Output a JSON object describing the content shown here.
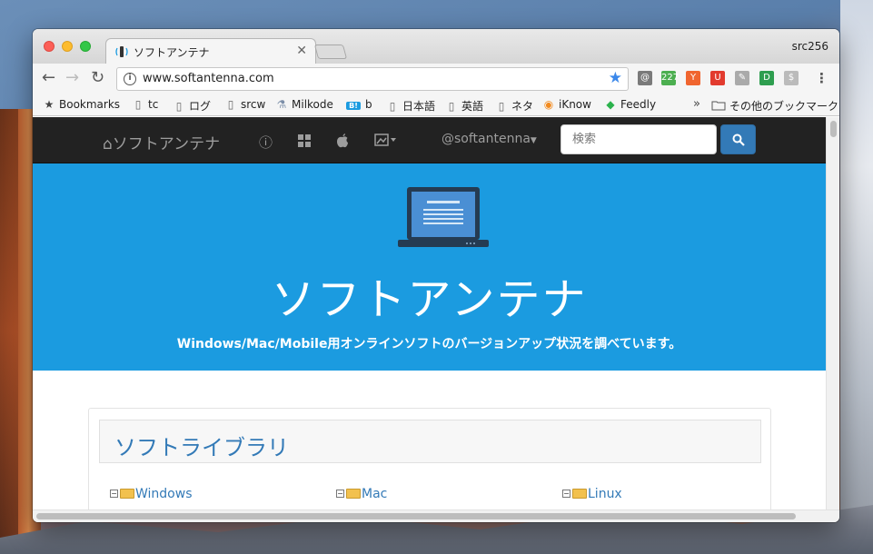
{
  "browser": {
    "tab_title": "ソフトアンテナ",
    "tab_close": "✕",
    "profile_name": "src256",
    "url": "www.softantenna.com",
    "extensions": [
      {
        "name": "clipper",
        "label": "@",
        "color": "#7a7a7a"
      },
      {
        "name": "badge",
        "label": "227",
        "color": "#4caf50"
      },
      {
        "name": "hacker-news",
        "label": "Y",
        "color": "#f0652f"
      },
      {
        "name": "ublock",
        "label": "U",
        "color": "#e23b2e"
      },
      {
        "name": "pin",
        "label": "✎",
        "color": "#aaaaaa"
      },
      {
        "name": "green-d",
        "label": "D",
        "color": "#2e9e4f"
      },
      {
        "name": "dollar",
        "label": "$",
        "color": "#bbbbbb"
      }
    ],
    "bookmarks": [
      {
        "label": "Bookmarks",
        "icon": "star-icon"
      },
      {
        "label": "tc",
        "icon": "page-icon"
      },
      {
        "label": "ログ",
        "icon": "page-icon"
      },
      {
        "label": "srcw",
        "icon": "page-icon"
      },
      {
        "label": "Milkode",
        "icon": "flask-icon"
      },
      {
        "label": "b",
        "icon": "hatena-icon"
      },
      {
        "label": "日本語",
        "icon": "page-icon"
      },
      {
        "label": "英語",
        "icon": "page-icon"
      },
      {
        "label": "ネタ",
        "icon": "page-icon"
      },
      {
        "label": "iKnow",
        "icon": "iknow-icon"
      },
      {
        "label": "Feedly",
        "icon": "feedly-icon"
      }
    ],
    "bookmarks_overflow": "»",
    "other_bookmarks": "その他のブックマーク"
  },
  "site": {
    "brand": "ソフトアンテナ",
    "account": "@softantenna",
    "search_placeholder": "検索",
    "hero_title": "ソフトアンテナ",
    "hero_subtitle": "Windows/Mac/Mobile用オンラインソフトのバージョンアップ状況を調べています。",
    "library_title": "ソフトライブラリ",
    "categories": [
      "Windows",
      "Mac",
      "Linux"
    ]
  },
  "colors": {
    "hero": "#1b9be0",
    "navbar": "#222222",
    "link": "#337ab7"
  }
}
